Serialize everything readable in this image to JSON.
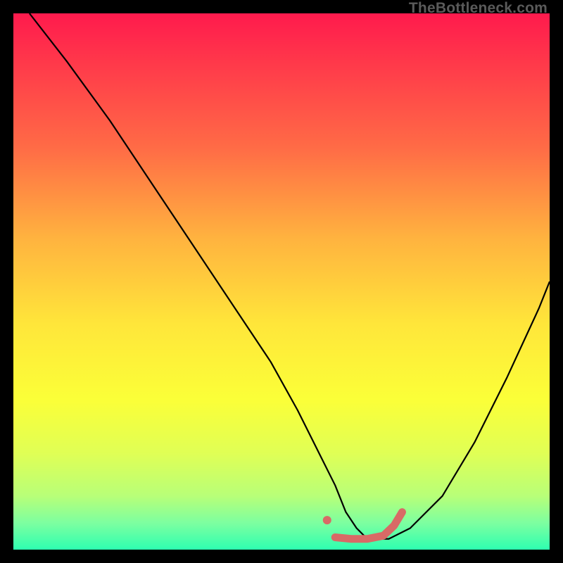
{
  "watermark": "TheBottleneck.com",
  "chart_data": {
    "type": "line",
    "title": "",
    "xlabel": "",
    "ylabel": "",
    "xlim": [
      0,
      100
    ],
    "ylim": [
      0,
      100
    ],
    "background_gradient": {
      "stops": [
        {
          "offset": 0.0,
          "color": "#ff1a4d"
        },
        {
          "offset": 0.1,
          "color": "#ff3b4a"
        },
        {
          "offset": 0.25,
          "color": "#ff6b46"
        },
        {
          "offset": 0.42,
          "color": "#ffb33f"
        },
        {
          "offset": 0.58,
          "color": "#ffe63a"
        },
        {
          "offset": 0.72,
          "color": "#fbff38"
        },
        {
          "offset": 0.82,
          "color": "#e0ff55"
        },
        {
          "offset": 0.9,
          "color": "#b8ff78"
        },
        {
          "offset": 0.95,
          "color": "#7dffa0"
        },
        {
          "offset": 1.0,
          "color": "#2effb0"
        }
      ]
    },
    "series": [
      {
        "name": "bottleneck-curve",
        "color": "#000000",
        "width": 2.2,
        "x": [
          3,
          10,
          18,
          26,
          34,
          42,
          48,
          53,
          57,
          60,
          62,
          64,
          66,
          70,
          74,
          80,
          86,
          92,
          98,
          100
        ],
        "y": [
          100,
          91,
          80,
          68,
          56,
          44,
          35,
          26,
          18,
          12,
          7,
          4,
          2,
          2,
          4,
          10,
          20,
          32,
          45,
          50
        ]
      },
      {
        "name": "optimal-zone-marker",
        "color": "#d86a66",
        "width": 11,
        "linecap": "round",
        "dot_x": 58.5,
        "dot_y": 5.5,
        "dot_r": 6,
        "x": [
          60,
          63,
          66,
          69,
          71,
          72.5
        ],
        "y": [
          2.3,
          2.0,
          2.0,
          2.6,
          4.5,
          7.0
        ]
      }
    ]
  }
}
